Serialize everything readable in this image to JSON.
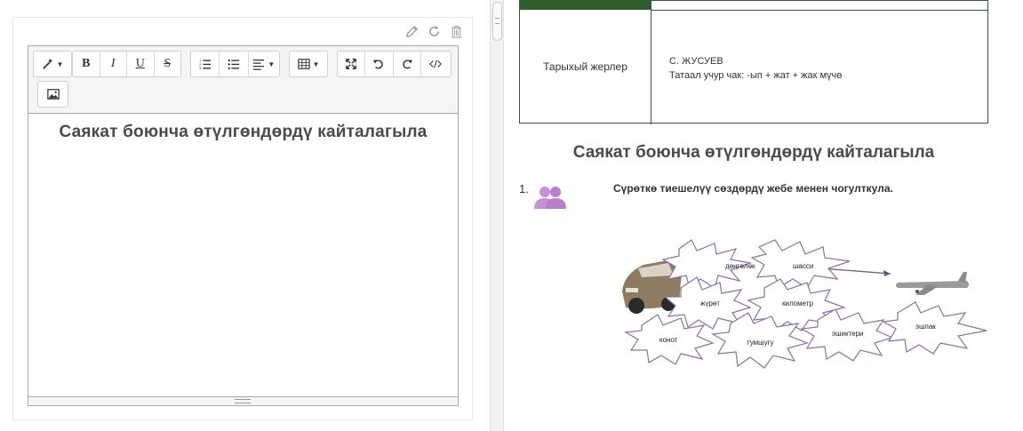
{
  "panel": {
    "actions": [
      {
        "name": "pencil-icon"
      },
      {
        "name": "refresh-icon"
      },
      {
        "name": "trash-icon"
      }
    ]
  },
  "toolbar": {
    "style_label": "style",
    "bold": "B",
    "italic": "I",
    "underline": "U",
    "strike": "S"
  },
  "editor": {
    "content_title": "Саякат боюнча өтүлгөндөрдү кайталагыла"
  },
  "preview": {
    "table": {
      "left_cell": "Тарыхый жерлер",
      "right_line1": "С. ЖУСУЕВ",
      "right_line2": "Татаал учур чак: -ып + жат + жак мүчө"
    },
    "title": "Саякат боюнча өтүлгөндөрдү кайталагыла",
    "list_number": "1.",
    "task_text": "Сүрөткө тиешелүү сөздөрдү жебе менен чогулткула.",
    "words": [
      "дөңгөлөк",
      "шасси",
      "жүрөт",
      "километр",
      "конот",
      "тумшугу",
      "эшиктери",
      "эшпак"
    ],
    "colors": {
      "table_border": "#2f5e2f",
      "star_stroke": "#8a6fa8",
      "people_icon": "#c98fd6"
    }
  }
}
